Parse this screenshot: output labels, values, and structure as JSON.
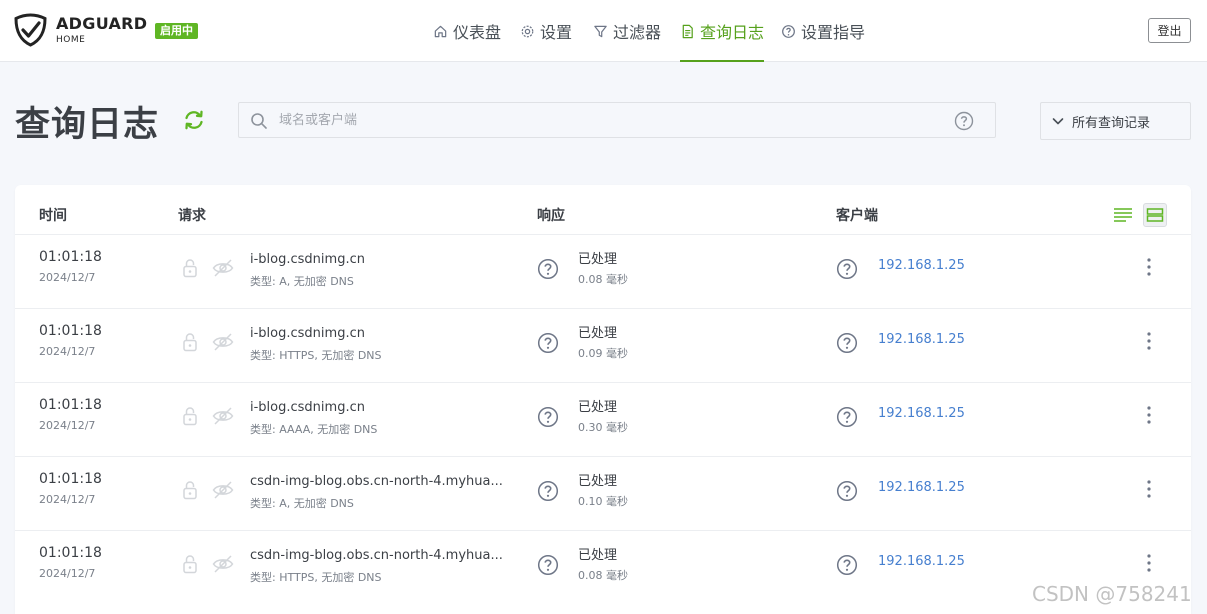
{
  "header": {
    "brand_name": "ADGUARD",
    "brand_sub": "HOME",
    "status_badge": "启用中",
    "nav": [
      {
        "label": "仪表盘",
        "icon": "home-icon",
        "active": false
      },
      {
        "label": "设置",
        "icon": "gear-icon",
        "active": false
      },
      {
        "label": "过滤器",
        "icon": "filter-icon",
        "active": false
      },
      {
        "label": "查询日志",
        "icon": "document-icon",
        "active": true
      },
      {
        "label": "设置指导",
        "icon": "help-circle-icon",
        "active": false
      }
    ],
    "logout_label": "登出"
  },
  "page": {
    "title": "查询日志",
    "search_placeholder": "域名或客户端",
    "filter_label": "所有查询记录"
  },
  "table": {
    "columns": {
      "time": "时间",
      "request": "请求",
      "response": "响应",
      "client": "客户端"
    },
    "rows": [
      {
        "time": "01:01:18",
        "date": "2024/12/7",
        "domain": "i-blog.csdnimg.cn",
        "type": "类型: A, 无加密 DNS",
        "status": "已处理",
        "elapsed": "0.08 毫秒",
        "client": "192.168.1.25"
      },
      {
        "time": "01:01:18",
        "date": "2024/12/7",
        "domain": "i-blog.csdnimg.cn",
        "type": "类型: HTTPS, 无加密 DNS",
        "status": "已处理",
        "elapsed": "0.09 毫秒",
        "client": "192.168.1.25"
      },
      {
        "time": "01:01:18",
        "date": "2024/12/7",
        "domain": "i-blog.csdnimg.cn",
        "type": "类型: AAAA, 无加密 DNS",
        "status": "已处理",
        "elapsed": "0.30 毫秒",
        "client": "192.168.1.25"
      },
      {
        "time": "01:01:18",
        "date": "2024/12/7",
        "domain": "csdn-img-blog.obs.cn-north-4.myhua...",
        "type": "类型: A, 无加密 DNS",
        "status": "已处理",
        "elapsed": "0.10 毫秒",
        "client": "192.168.1.25"
      },
      {
        "time": "01:01:18",
        "date": "2024/12/7",
        "domain": "csdn-img-blog.obs.cn-north-4.myhua...",
        "type": "类型: HTTPS, 无加密 DNS",
        "status": "已处理",
        "elapsed": "0.08 毫秒",
        "client": "192.168.1.25"
      }
    ]
  },
  "watermark": "CSDN @758241",
  "colors": {
    "accent": "#56a11c",
    "badge": "#5fb624",
    "link": "#467fcf"
  }
}
